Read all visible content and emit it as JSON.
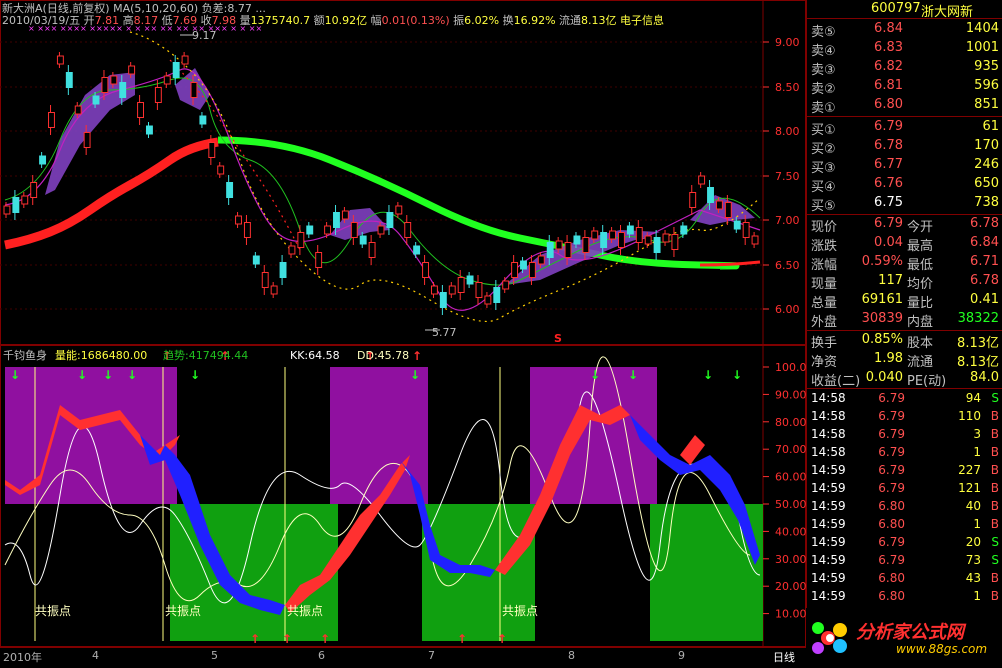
{
  "header": {
    "line1": "新大洲A(日线,前复权)  MA(5,10,20,60) 负差:8.77 ...",
    "date": "2010/03/19/五",
    "open_label": "开",
    "open": "7.81",
    "high_label": "高",
    "high": "8.17",
    "low_label": "低",
    "low": "7.69",
    "close_label": "收",
    "close": "7.98",
    "vol_label": "量",
    "vol": "1375740.7",
    "amount_label": "额",
    "amount": "10.92亿",
    "chg_label": "幅",
    "chg": "0.01(0.13%)",
    "amp_label": "振",
    "amp": "6.02%",
    "turn_label": "换",
    "turn": "16.92%",
    "float_label": "流通",
    "float": "8.13亿",
    "sector": "电子信息"
  },
  "price_chart": {
    "high_marker": "9.17",
    "low_marker": "5.77",
    "s_marker": "S",
    "y_ticks": [
      "9.00",
      "8.50",
      "8.00",
      "7.50",
      "7.00",
      "6.50",
      "6.00"
    ],
    "ma_colors": {
      "red": "#ff2020",
      "green": "#20ff20",
      "violet": "#8020c0",
      "gold": "#ffcc00"
    }
  },
  "indicator": {
    "name": "千钧鱼身",
    "vol_label": "量能:1686480.00",
    "trend_label": "趋势:417494.44",
    "kk_label": "KK:64.58",
    "dd_label": "DD:45.78",
    "y_ticks": [
      "100.0",
      "90.00",
      "80.00",
      "70.00",
      "60.00",
      "50.00",
      "40.00",
      "30.00",
      "20.00",
      "10.00"
    ],
    "resonance_labels": [
      "共振点",
      "共振点",
      "共振点",
      "共振点"
    ]
  },
  "x_axis": {
    "labels": [
      "2010年",
      "4",
      "5",
      "6",
      "7",
      "8",
      "9"
    ],
    "period": "日线"
  },
  "quote": {
    "code": "600797",
    "name": "浙大网新",
    "asks": [
      {
        "label": "卖⑤",
        "price": "6.84",
        "vol": "1404"
      },
      {
        "label": "卖④",
        "price": "6.83",
        "vol": "1001"
      },
      {
        "label": "卖③",
        "price": "6.82",
        "vol": "935"
      },
      {
        "label": "卖②",
        "price": "6.81",
        "vol": "596"
      },
      {
        "label": "卖①",
        "price": "6.80",
        "vol": "851"
      }
    ],
    "bids": [
      {
        "label": "买①",
        "price": "6.79",
        "vol": "61"
      },
      {
        "label": "买②",
        "price": "6.78",
        "vol": "170"
      },
      {
        "label": "买③",
        "price": "6.77",
        "vol": "246"
      },
      {
        "label": "买④",
        "price": "6.76",
        "vol": "650"
      },
      {
        "label": "买⑤",
        "price": "6.75",
        "vol": "738"
      }
    ],
    "stats": [
      {
        "l1": "现价",
        "v1": "6.79",
        "l2": "今开",
        "v2": "6.78"
      },
      {
        "l1": "涨跌",
        "v1": "0.04",
        "l2": "最高",
        "v2": "6.84"
      },
      {
        "l1": "涨幅",
        "v1": "0.59%",
        "l2": "最低",
        "v2": "6.71"
      },
      {
        "l1": "现量",
        "v1": "117",
        "l2": "均价",
        "v2": "6.78"
      },
      {
        "l1": "总量",
        "v1": "69161",
        "l2": "量比",
        "v2": "0.41"
      },
      {
        "l1": "外盘",
        "v1": "30839",
        "l2": "内盘",
        "v2": "38322"
      }
    ],
    "finance": [
      {
        "l1": "换手",
        "v1": "0.85%",
        "l2": "股本",
        "v2": "8.13亿"
      },
      {
        "l1": "净资",
        "v1": "1.98",
        "l2": "流通",
        "v2": "8.13亿"
      },
      {
        "l1": "收益(二)",
        "v1": "0.040",
        "l2": "PE(动)",
        "v2": "84.0"
      }
    ],
    "ticks": [
      {
        "t": "14:58",
        "p": "6.79",
        "v": "94",
        "d": "S"
      },
      {
        "t": "14:58",
        "p": "6.79",
        "v": "110",
        "d": "B"
      },
      {
        "t": "14:58",
        "p": "6.79",
        "v": "3",
        "d": "B"
      },
      {
        "t": "14:58",
        "p": "6.79",
        "v": "1",
        "d": "B"
      },
      {
        "t": "14:59",
        "p": "6.79",
        "v": "227",
        "d": "B"
      },
      {
        "t": "14:59",
        "p": "6.79",
        "v": "121",
        "d": "B"
      },
      {
        "t": "14:59",
        "p": "6.80",
        "v": "40",
        "d": "B"
      },
      {
        "t": "14:59",
        "p": "6.80",
        "v": "1",
        "d": "B"
      },
      {
        "t": "14:59",
        "p": "6.79",
        "v": "20",
        "d": "S"
      },
      {
        "t": "14:59",
        "p": "6.79",
        "v": "73",
        "d": "S"
      },
      {
        "t": "14:59",
        "p": "6.80",
        "v": "43",
        "d": "B"
      },
      {
        "t": "14:59",
        "p": "6.80",
        "v": "1",
        "d": "B"
      }
    ]
  },
  "watermark": {
    "cn": "分析家公式网",
    "url": "www.88gs.com"
  }
}
